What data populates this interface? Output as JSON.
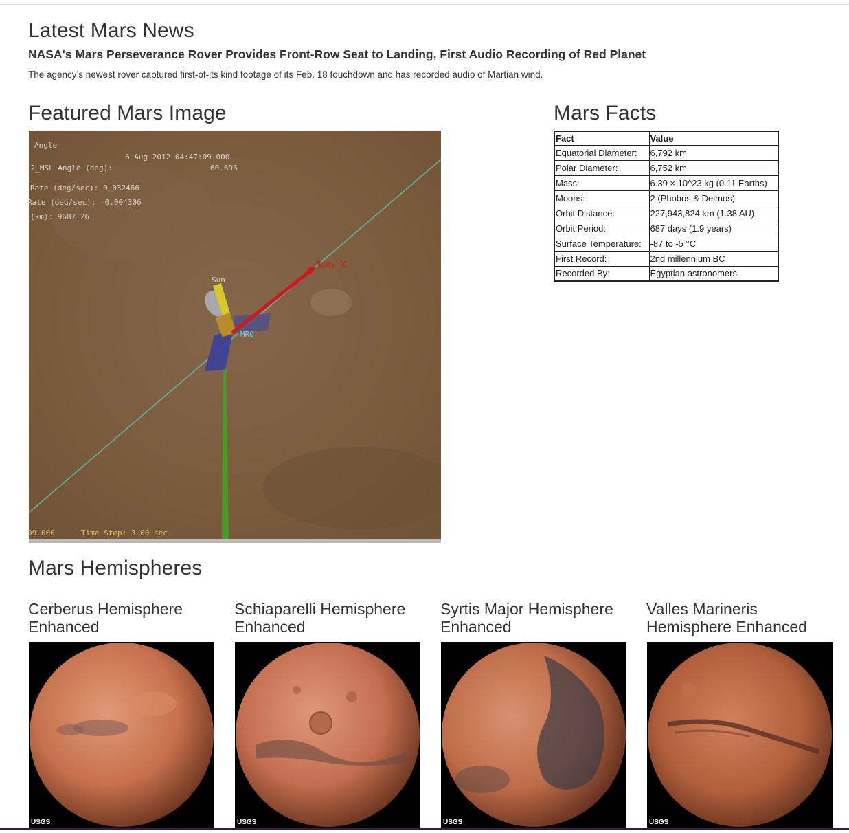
{
  "news": {
    "section_title": "Latest Mars News",
    "headline": "NASA's Mars Perseverance Rover Provides Front-Row Seat to Landing, First Audio Recording of Red Planet",
    "teaser": "The agency’s newest rover captured first-of-its kind footage of its Feb. 18 touchdown and has recorded audio of Martian wind."
  },
  "featured": {
    "section_title": "Featured Mars Image",
    "overlay": {
      "line1": "Angle",
      "line2": "6 Aug 2012 04:47:09.000",
      "line3": "L2_MSL Angle (deg):",
      "line3_value": "60.696",
      "line4": "Rate (deg/sec):  0.032466",
      "line5": "Rate (deg/sec): -0.004306",
      "line6": "(km): 9687.26",
      "label_sun": "Sun",
      "label_body": "Body_X",
      "label_mro": "MRO",
      "footer_left": "09.000",
      "footer_right": "Time Step: 3.00 sec"
    }
  },
  "facts": {
    "section_title": "Mars Facts",
    "headers": [
      "Fact",
      "Value"
    ],
    "rows": [
      [
        "Equatorial Diameter:",
        "6,792 km"
      ],
      [
        "Polar Diameter:",
        "6,752 km"
      ],
      [
        "Mass:",
        "6.39 × 10^23 kg (0.11 Earths)"
      ],
      [
        "Moons:",
        "2 (Phobos & Deimos)"
      ],
      [
        "Orbit Distance:",
        "227,943,824 km (1.38 AU)"
      ],
      [
        "Orbit Period:",
        "687 days (1.9 years)"
      ],
      [
        "Surface Temperature:",
        "-87 to -5 °C"
      ],
      [
        "First Record:",
        "2nd millennium BC"
      ],
      [
        "Recorded By:",
        "Egyptian astronomers"
      ]
    ]
  },
  "hemispheres": {
    "section_title": "Mars Hemispheres",
    "items": [
      {
        "title": "Cerberus Hemisphere Enhanced",
        "logo": "USGS"
      },
      {
        "title": "Schiaparelli Hemisphere Enhanced",
        "logo": "USGS"
      },
      {
        "title": "Syrtis Major Hemisphere Enhanced",
        "logo": "USGS"
      },
      {
        "title": "Valles Marineris Hemisphere Enhanced",
        "logo": "USGS"
      }
    ]
  },
  "colors": {
    "text": "#333333",
    "mars_surface": "#7b5c3d",
    "planet": "#c8704a",
    "bottom_bar": "#3a1a4a"
  }
}
